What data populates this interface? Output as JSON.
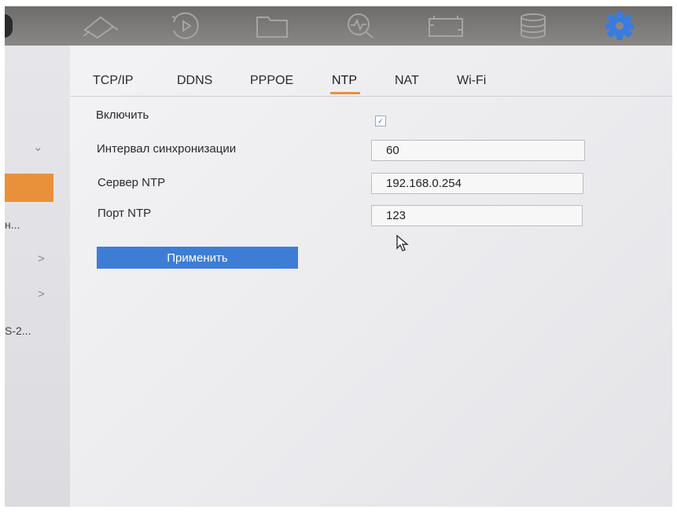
{
  "toolbar": {
    "icons": [
      "camera-icon",
      "playback-icon",
      "folder-icon",
      "search-icon",
      "device-icon",
      "storage-icon",
      "settings-gear-icon"
    ],
    "active_icon": "settings-gear-icon",
    "accent_color": "#3a7be0"
  },
  "sidebar": {
    "truncated_texts": [
      "н...",
      "S-2..."
    ],
    "active_color": "#e9903a"
  },
  "tabs": [
    {
      "label": "TCP/IP"
    },
    {
      "label": "DDNS"
    },
    {
      "label": "PPPOE"
    },
    {
      "label": "NTP",
      "active": true
    },
    {
      "label": "NAT"
    },
    {
      "label": "Wi-Fi"
    }
  ],
  "form": {
    "enable_label": "Включить",
    "enable_checked": true,
    "interval_label": "Интервал синхронизации",
    "interval_value": "60",
    "server_label": "Сервер NTP",
    "server_value": "192.168.0.254",
    "port_label": "Порт NTP",
    "port_value": "123",
    "apply_label": "Применить"
  },
  "colors": {
    "tab_underline": "#e9903a",
    "apply_button": "#3d7dd6"
  }
}
